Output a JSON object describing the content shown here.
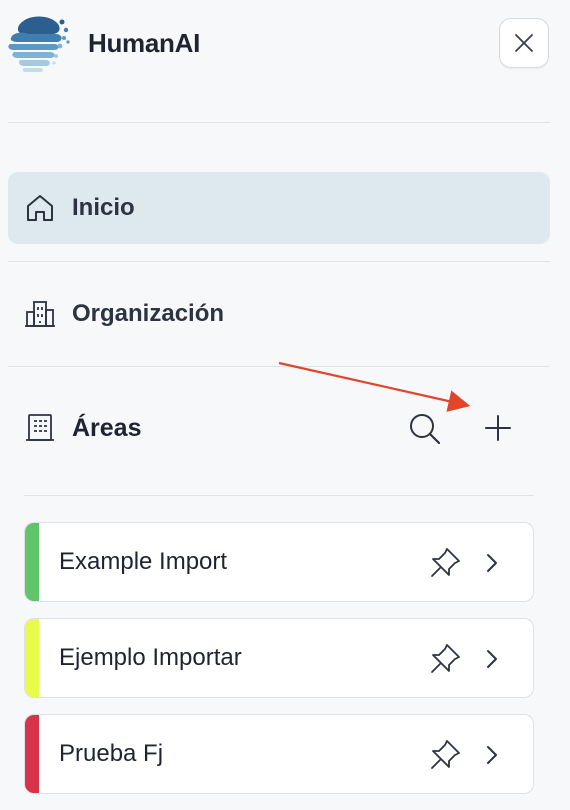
{
  "app": {
    "brand": "HumanAI"
  },
  "nav": {
    "items": [
      {
        "label": "Inicio",
        "icon": "home-icon",
        "active": true
      },
      {
        "label": "Organización",
        "icon": "building-icon",
        "active": false
      }
    ]
  },
  "areas": {
    "title": "Áreas",
    "icon": "areas-building-icon",
    "items": [
      {
        "name": "Example Import",
        "color": "#5fc46a"
      },
      {
        "name": "Ejemplo Importar",
        "color": "#e6fb4a"
      },
      {
        "name": "Prueba Fj",
        "color": "#d8334a"
      }
    ]
  },
  "colors": {
    "active_nav_bg": "#dde9ef",
    "annotation_arrow": "#e0462c",
    "logo_blue": "#2f6f9f"
  }
}
